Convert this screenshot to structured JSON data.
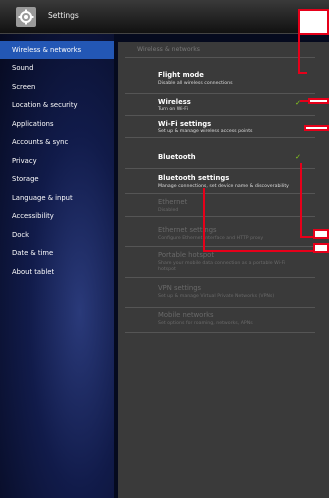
{
  "titlebar": {
    "title": "Settings",
    "icon": "gear-icon"
  },
  "sidebar": {
    "items": [
      {
        "label": "Wireless & networks",
        "selected": true
      },
      {
        "label": "Sound"
      },
      {
        "label": "Screen"
      },
      {
        "label": "Location & security"
      },
      {
        "label": "Applications"
      },
      {
        "label": "Accounts & sync"
      },
      {
        "label": "Privacy"
      },
      {
        "label": "Storage"
      },
      {
        "label": "Language & input"
      },
      {
        "label": "Accessibility"
      },
      {
        "label": "Dock"
      },
      {
        "label": "Date & time"
      },
      {
        "label": "About tablet"
      }
    ]
  },
  "main": {
    "section_header": "Wireless & networks",
    "rows": [
      {
        "title": "Flight mode",
        "subtitle": "Disable all wireless connections",
        "enabled": true,
        "checked": false
      },
      {
        "title": "Wireless",
        "subtitle": "Turn on Wi-Fi",
        "enabled": true,
        "checked": true
      },
      {
        "title": "Wi-Fi settings",
        "subtitle": "Set up & manage wireless access points",
        "enabled": true,
        "checked": false
      },
      {
        "title": "Bluetooth",
        "subtitle": "",
        "enabled": true,
        "checked": true
      },
      {
        "title": "Bluetooth settings",
        "subtitle": "Manage connections, set device name & discoverability",
        "enabled": true,
        "checked": false
      },
      {
        "title": "Ethernet",
        "subtitle": "Disabled",
        "enabled": false,
        "checked": false
      },
      {
        "title": "Ethernet settings",
        "subtitle": "Configure Ethernet interface and HTTP proxy",
        "enabled": false,
        "checked": false
      },
      {
        "title": "Portable hotspot",
        "subtitle": "Share your mobile data connection as a portable Wi-Fi",
        "subtitle2": "hotspot",
        "enabled": false,
        "checked": false
      },
      {
        "title": "VPN settings",
        "subtitle": "Set up & manage Virtual Private Networks (VPNs)",
        "enabled": false,
        "checked": false
      },
      {
        "title": "Mobile networks",
        "subtitle": "Set options for roaming, networks, APNs",
        "enabled": false,
        "checked": false
      }
    ],
    "check_glyph": "✓"
  },
  "colors": {
    "selected_bg": "#2357b5",
    "check": "#8bd31b",
    "annotation": "#e6001a",
    "content_bg": "#3a3a3a"
  }
}
